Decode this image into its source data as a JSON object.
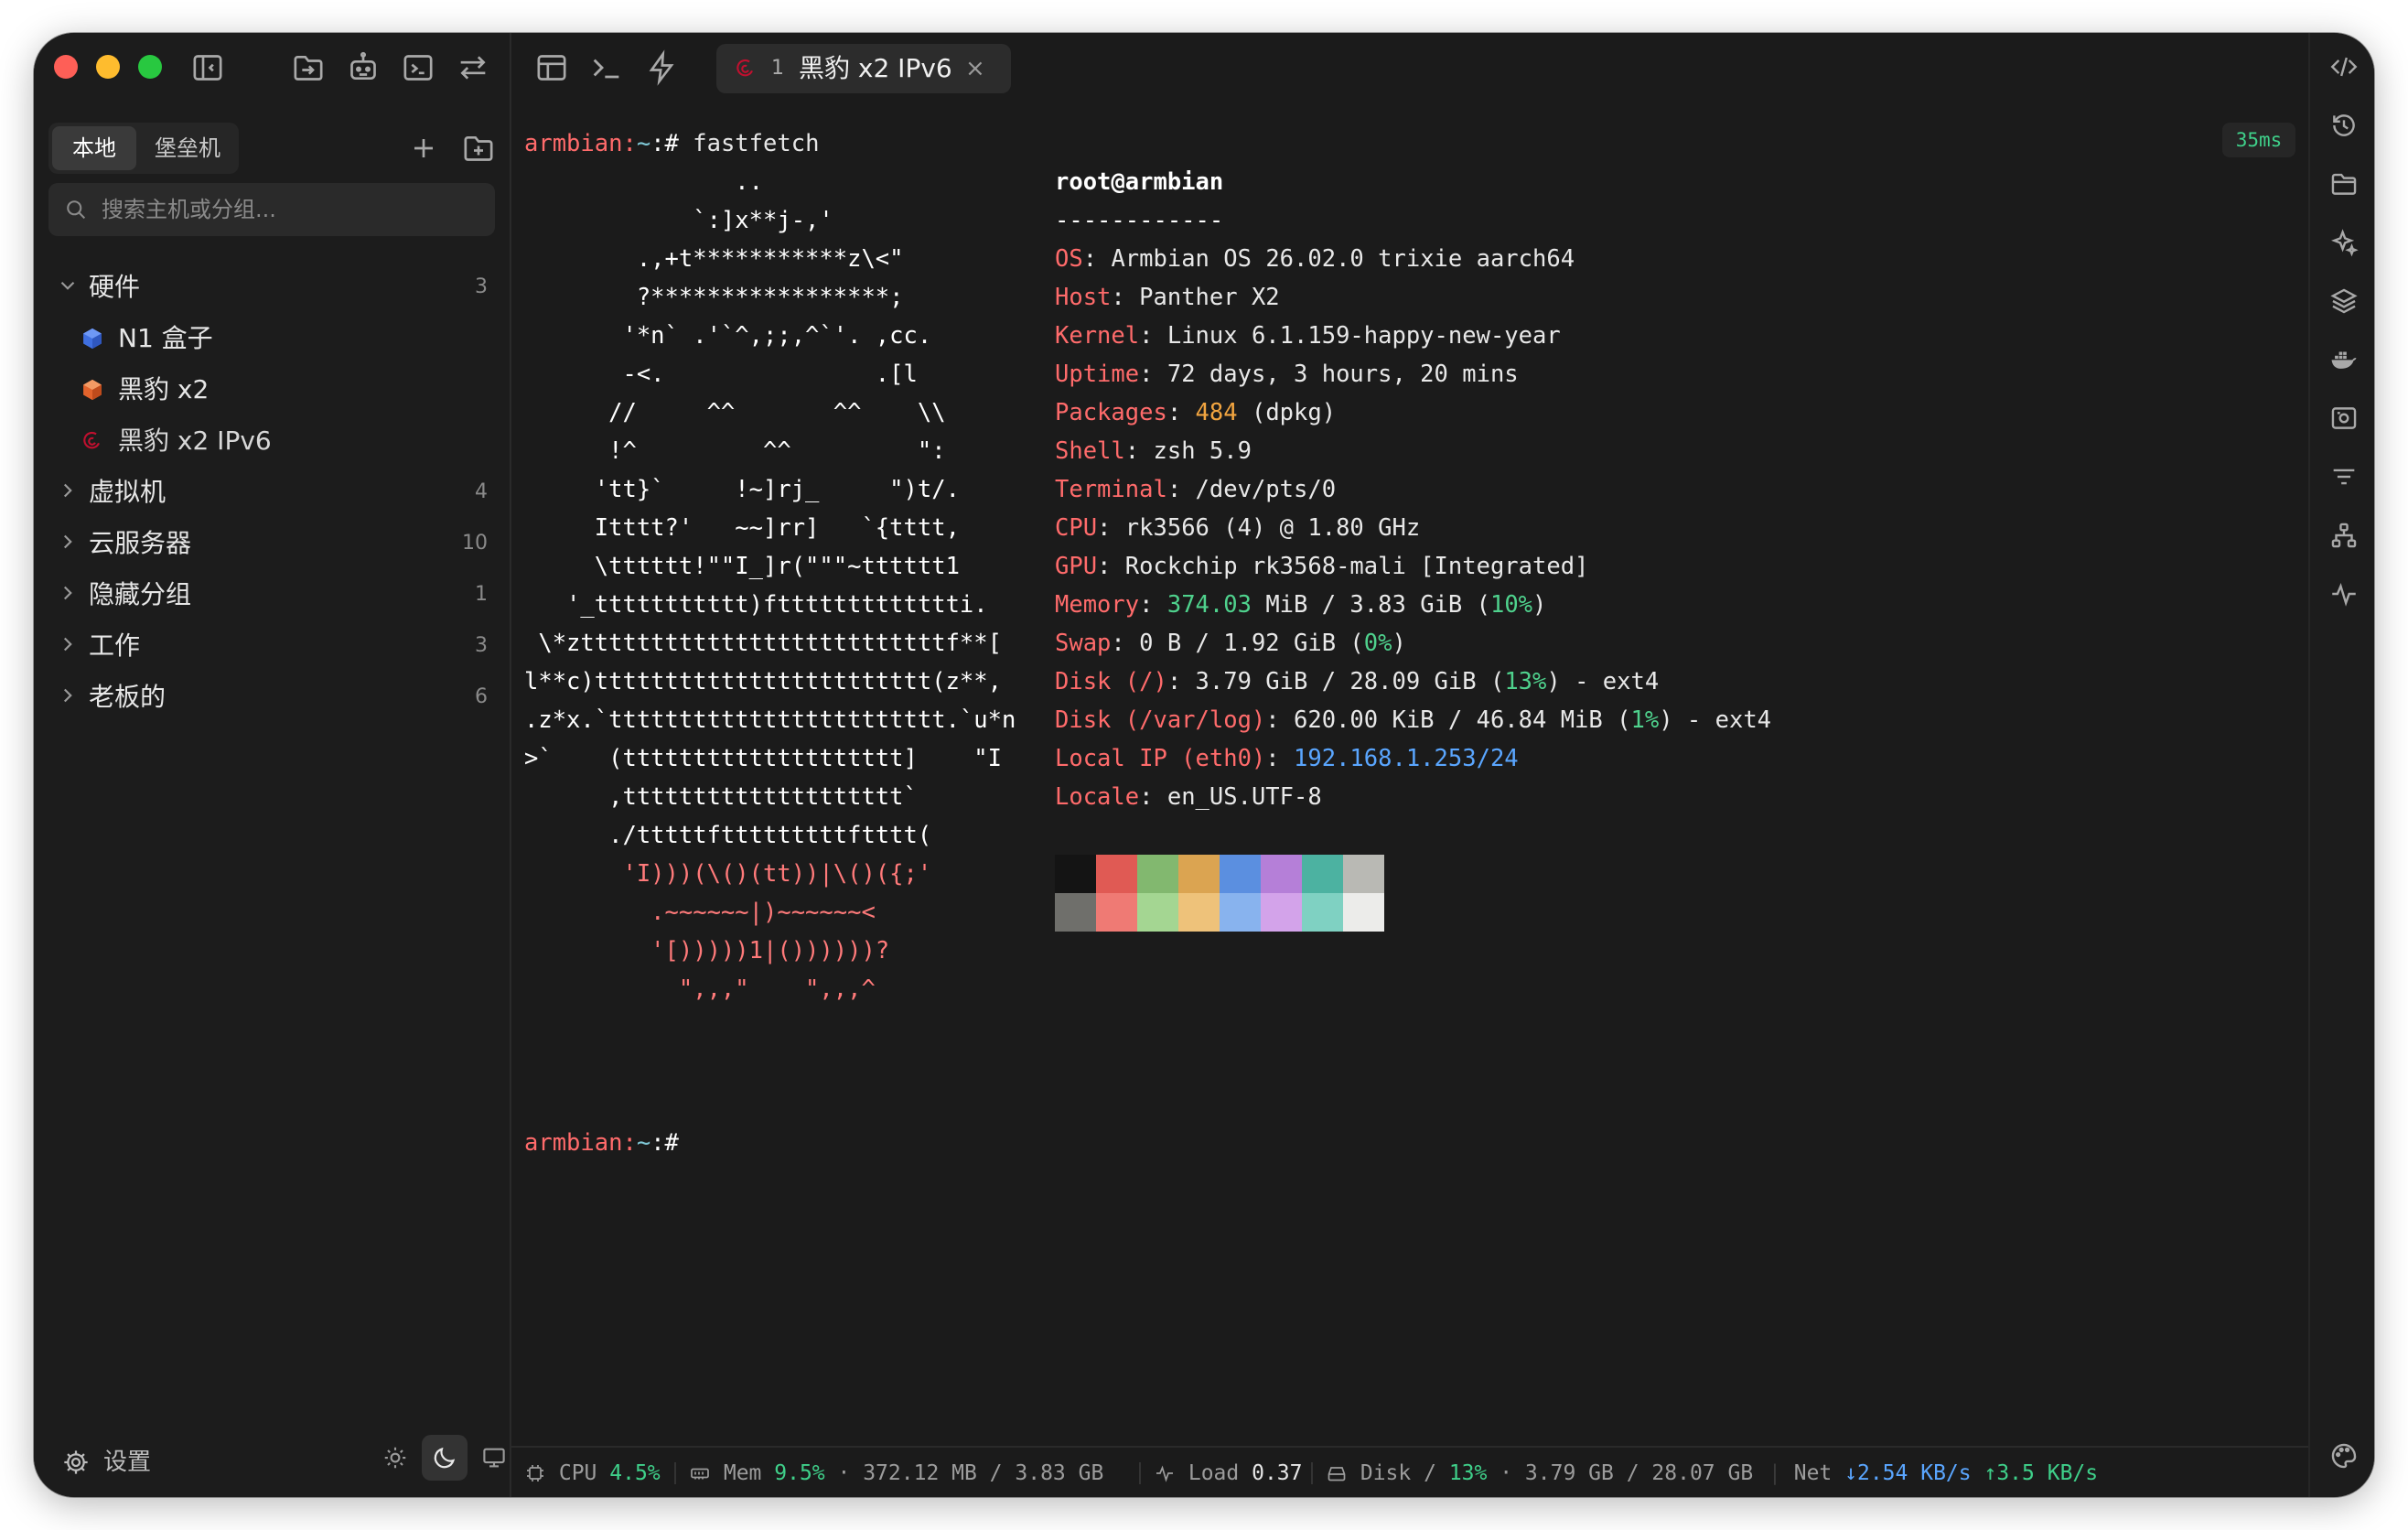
{
  "titlebar": {
    "tab": {
      "num": "1",
      "title": "黑豹 x2 IPv6",
      "close": "×"
    }
  },
  "sidebar": {
    "segments": [
      "本地",
      "堡垒机"
    ],
    "search_placeholder": "搜索主机或分组...",
    "groups": [
      {
        "label": "硬件",
        "count": "3",
        "expanded": true,
        "hosts": [
          {
            "label": "N1 盒子",
            "icon": "box-icon-blue"
          },
          {
            "label": "黑豹 x2",
            "icon": "box-icon-orange"
          },
          {
            "label": "黑豹 x2 IPv6",
            "icon": "debian-icon"
          }
        ]
      },
      {
        "label": "虚拟机",
        "count": "4"
      },
      {
        "label": "云服务器",
        "count": "10"
      },
      {
        "label": "隐藏分组",
        "count": "1"
      },
      {
        "label": "工作",
        "count": "3"
      },
      {
        "label": "老板的",
        "count": "6"
      }
    ],
    "settings_label": "设置"
  },
  "terminal": {
    "prompt_user": "armbian",
    "prompt_path": "~",
    "prompt_suffix": ":#",
    "command": "fastfetch",
    "logo": [
      "               ..",
      "            `:]x**j-,'",
      "        .,+t***********z\\<\"",
      "        ?*****************;",
      "       '*n` .'`^,;;,^`'. ,cc.",
      "       -<.               .[l",
      "      //     ^^       ^^    \\\\",
      "      !^         ^^         \":",
      "     'tt}`     !~]rj_     \")t/.",
      "     Itttt?'   ~~]rr]   `{tttt,",
      "     \\tttttt!\"\"I_]r(\"\"\"~tttttt1",
      "   '_ttttttttttt)fttttttttttttti.",
      " \\*zttttttttttttttttttttttttttf**[",
      "l**c)tttttttttttttttttttttttt(z**,",
      ".z*x.`tttttttttttttttttttttttt.`u*n",
      ">`    (tttttttttttttttttttt]    \"I",
      "      ,tttttttttttttttttttt`",
      "      ./tttttftttttttttftttt(",
      "       'I)))(\\()(tt))|\\()({;'",
      "         .~~~~~~|)~~~~~~<",
      "         '[)))))1|())))))?",
      "           \",,,\"    \",,,^"
    ],
    "user_host": "root@armbian",
    "separator": "------------",
    "info": [
      {
        "k": "OS",
        "v": "Armbian OS 26.02.0 trixie aarch64"
      },
      {
        "k": "Host",
        "v": "Panther X2"
      },
      {
        "k": "Kernel",
        "v": "Linux 6.1.159-happy-new-year"
      },
      {
        "k": "Uptime",
        "v": "72 days, 3 hours, 20 mins"
      },
      {
        "k": "Packages",
        "v_num": "484",
        "v": " (dpkg)"
      },
      {
        "k": "Shell",
        "v": "zsh 5.9"
      },
      {
        "k": "Terminal",
        "v": "/dev/pts/0"
      },
      {
        "k": "CPU",
        "v": "rk3566 (4) @ 1.80 GHz"
      },
      {
        "k": "GPU",
        "v": "Rockchip rk3568-mali [Integrated]"
      },
      {
        "k": "Memory",
        "v_num": "374.03",
        "v": " MiB / 3.83 GiB (",
        "pct": "10%",
        "tail": ")"
      },
      {
        "k": "Swap",
        "v": "0 B / 1.92 GiB (",
        "pct": "0%",
        "tail": ")"
      },
      {
        "k": "Disk (/)",
        "v": "3.79 GiB / 28.09 GiB (",
        "pct": "13%",
        "tail": ") - ext4"
      },
      {
        "k": "Disk (/var/log)",
        "v": "620.00 KiB / 46.84 MiB (",
        "pct": "1%",
        "tail": ") - ext4"
      },
      {
        "k": "Local IP (eth0)",
        "v_ip": "192.168.1.253/24"
      },
      {
        "k": "Locale",
        "v": "en_US.UTF-8"
      }
    ],
    "palette_top": [
      "#141414",
      "#e05a54",
      "#82b86f",
      "#dba451",
      "#5b8fe0",
      "#b57fd8",
      "#4cb2a1",
      "#b9b9b4"
    ],
    "palette_bottom": [
      "#6f6f6b",
      "#ef7a74",
      "#a4d692",
      "#eec27a",
      "#88b3ee",
      "#d3a3ea",
      "#7fd1c2",
      "#ececea"
    ],
    "latency": "35ms"
  },
  "statusbar": {
    "cpu_label": "CPU",
    "cpu_val": "4.5%",
    "mem_label": "Mem",
    "mem_pct": "9.5%",
    "mem_detail": "· 372.12 MB / 3.83 GB",
    "load_label": "Load",
    "load_val": "0.37",
    "disk_label": "Disk",
    "disk_path": "/",
    "disk_pct": "13%",
    "disk_detail": "· 3.79 GB / 28.07 GB",
    "net_label": "Net",
    "net_down": "2.54 KB/s",
    "net_up": "3.5 KB/s"
  },
  "colors": {
    "accent_green": "#3fd08a",
    "accent_blue": "#5aa6ff",
    "prompt": "#ff6b6b",
    "key": "#ff6b6b"
  }
}
